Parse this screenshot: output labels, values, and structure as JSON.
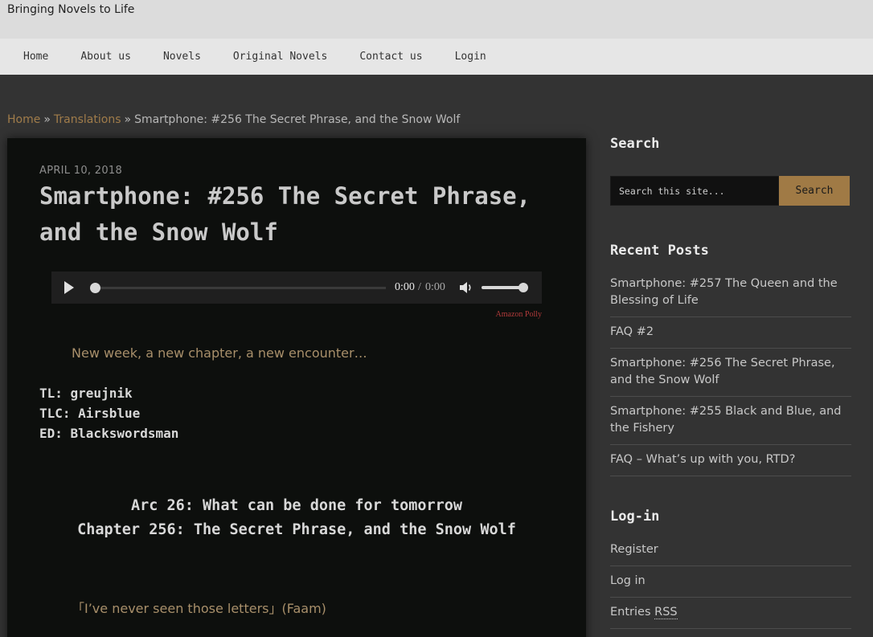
{
  "header": {
    "tagline": "Bringing Novels to Life"
  },
  "nav": {
    "items": [
      "Home",
      "About us",
      "Novels",
      "Original Novels",
      "Contact us",
      "Login"
    ]
  },
  "breadcrumb": {
    "home": "Home",
    "separator": "»",
    "category": "Translations",
    "current": "Smartphone: #256 The Secret Phrase, and the Snow Wolf"
  },
  "post": {
    "date": "April 10, 2018",
    "title": "Smartphone: #256 The Secret Phrase, and the Snow Wolf",
    "audio": {
      "current_time": "0:00",
      "separator": "/",
      "duration": "0:00",
      "progress": 0,
      "volume": 1.0,
      "credit": "Amazon Polly"
    },
    "intro": "New week, a new chapter, a new encounter…",
    "credits": [
      "TL: greujnik",
      "TLC: Airsblue",
      "ED: Blackswordsman"
    ],
    "arc_heading": "Arc 26: What can be done for tomorrow",
    "chapter_heading": "Chapter 256: The Secret Phrase, and the Snow Wolf",
    "first_line": "「I’ve never seen those letters」(Faam)"
  },
  "sidebar": {
    "search": {
      "title": "Search",
      "placeholder": "Search this site...",
      "button_label": "Search"
    },
    "recent_posts": {
      "title": "Recent Posts",
      "items": [
        "Smartphone: #257 The Queen and the Blessing of Life",
        "FAQ #2",
        "Smartphone: #256 The Secret Phrase, and the Snow Wolf",
        "Smartphone: #255 Black and Blue, and the Fishery",
        "FAQ – What’s up with you, RTD?"
      ]
    },
    "login": {
      "title": "Log-in",
      "register": "Register",
      "login": "Log in",
      "entries_prefix": "Entries",
      "rss": "RSS"
    }
  },
  "colors": {
    "accent": "#a07a45",
    "link": "#a07c4a",
    "background": "#333333",
    "article_bg": "#0d0f0d"
  }
}
